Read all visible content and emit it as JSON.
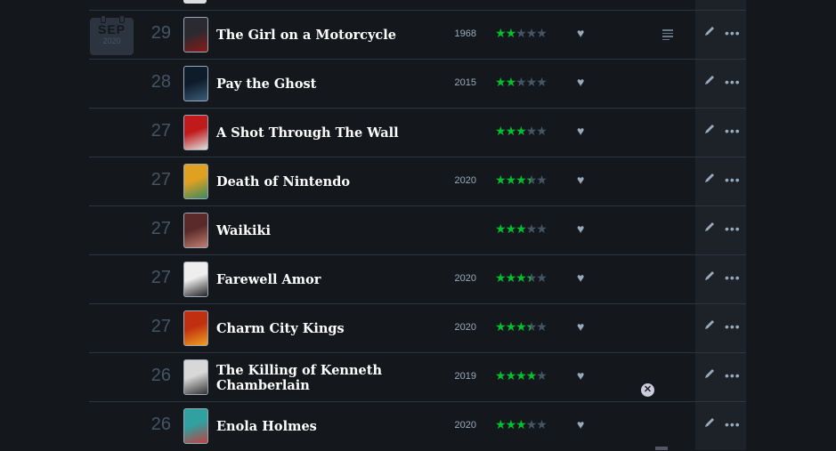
{
  "calendar": {
    "month": "SEP",
    "year": "2020"
  },
  "colors": {
    "star_on": "#00c030",
    "star_off": "#445566",
    "background": "#14181c",
    "actions_bg": "#1c2228"
  },
  "entries": [
    {
      "day": "29",
      "title": "The Girl on a Motorcycle",
      "year": "1968",
      "rating": 2,
      "has_review": true,
      "poster_colors": [
        "#2a2a30",
        "#8a1a18"
      ]
    },
    {
      "day": "28",
      "title": "Pay the Ghost",
      "year": "2015",
      "rating": 2,
      "has_review": false,
      "poster_colors": [
        "#0e1c2a",
        "#3c5c78"
      ]
    },
    {
      "day": "27",
      "title": "A Shot Through The Wall",
      "year": "",
      "rating": 3,
      "has_review": false,
      "poster_colors": [
        "#c01a1a",
        "#e0e0e0"
      ]
    },
    {
      "day": "27",
      "title": "Death of Nintendo",
      "year": "2020",
      "rating": 3.5,
      "has_review": false,
      "poster_colors": [
        "#e0a020",
        "#3a8a60"
      ]
    },
    {
      "day": "27",
      "title": "Waikiki",
      "year": "",
      "rating": 3,
      "has_review": false,
      "poster_colors": [
        "#5a2a2a",
        "#c08070"
      ]
    },
    {
      "day": "27",
      "title": "Farewell Amor",
      "year": "2020",
      "rating": 3.5,
      "has_review": false,
      "poster_colors": [
        "#eeeeee",
        "#222222"
      ]
    },
    {
      "day": "27",
      "title": "Charm City Kings",
      "year": "2020",
      "rating": 3.5,
      "has_review": false,
      "poster_colors": [
        "#c03010",
        "#f0a020"
      ]
    },
    {
      "day": "26",
      "title": "The Killing of Kenneth Chamberlain",
      "year": "2019",
      "rating": 4,
      "has_review": false,
      "poster_colors": [
        "#d8d8d8",
        "#333333"
      ]
    },
    {
      "day": "26",
      "title": "Enola Holmes",
      "year": "2020",
      "rating": 3,
      "has_review": false,
      "poster_colors": [
        "#30a0a0",
        "#c04040"
      ]
    }
  ],
  "icons": {
    "heart": "heart-icon",
    "review": "review-text-icon",
    "edit": "pencil-icon",
    "more": "more-icon",
    "close": "close-icon"
  }
}
